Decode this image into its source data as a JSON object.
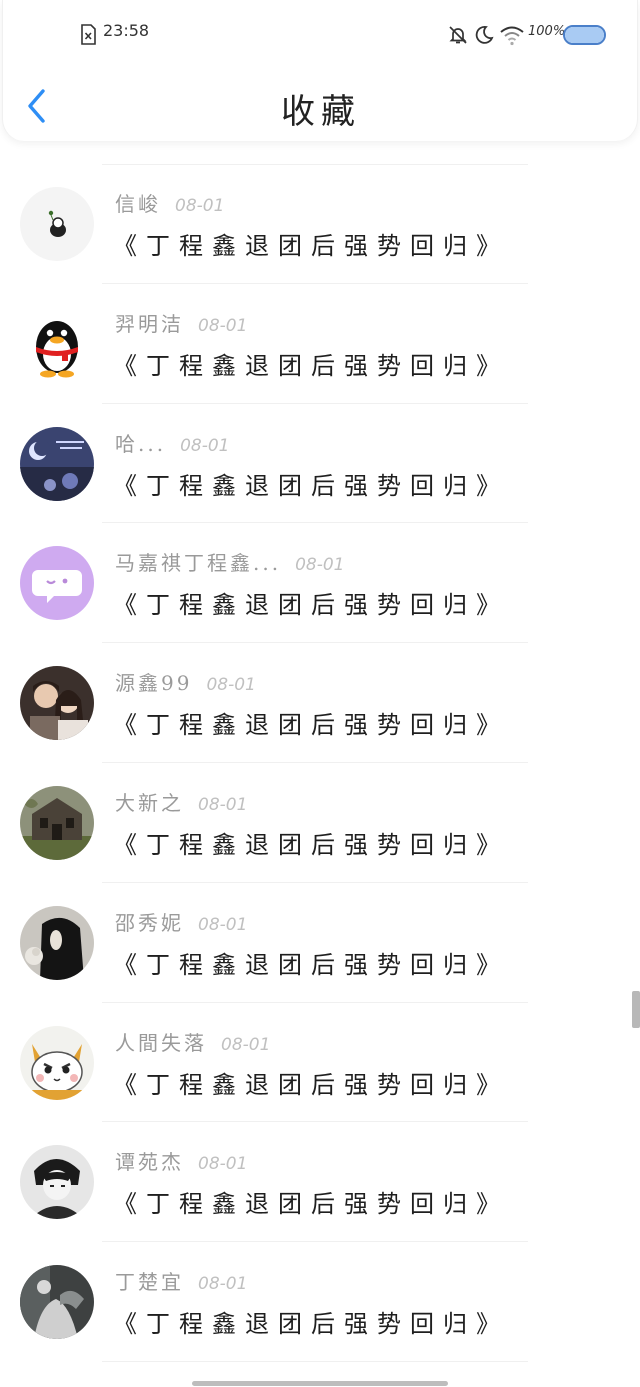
{
  "status_bar": {
    "time": "23:58",
    "battery_percent": "100%",
    "battery_level": 1.0
  },
  "header": {
    "title": "收藏",
    "back_icon": "chevron-left-icon",
    "accent_color": "#2e8ef5"
  },
  "items": [
    {
      "name": "信峻",
      "date": "08-01",
      "content": "《丁程鑫退团后强势回归》",
      "avatar": "white-ghost-avatar"
    },
    {
      "name": "羿明洁",
      "date": "08-01",
      "content": "《丁程鑫退团后强势回归》",
      "avatar": "penguin-avatar"
    },
    {
      "name": "哈...",
      "date": "08-01",
      "content": "《丁程鑫退团后强势回归》",
      "avatar": "night-sky-avatar"
    },
    {
      "name": "马嘉祺丁程鑫...",
      "date": "08-01",
      "content": "《丁程鑫退团后强势回归》",
      "avatar": "purple-chat-avatar"
    },
    {
      "name": "源鑫99",
      "date": "08-01",
      "content": "《丁程鑫退团后强势回归》",
      "avatar": "couple-photo-avatar"
    },
    {
      "name": "大新之",
      "date": "08-01",
      "content": "《丁程鑫退团后强势回归》",
      "avatar": "old-house-avatar"
    },
    {
      "name": "邵秀妮",
      "date": "08-01",
      "content": "《丁程鑫退团后强势回归》",
      "avatar": "dark-hair-avatar"
    },
    {
      "name": "人間失落",
      "date": "08-01",
      "content": "《丁程鑫退团后强势回归》",
      "avatar": "cartoon-cat-avatar"
    },
    {
      "name": "谭苑杰",
      "date": "08-01",
      "content": "《丁程鑫退团后强势回归》",
      "avatar": "anime-boy-avatar"
    },
    {
      "name": "丁楚宜",
      "date": "08-01",
      "content": "《丁程鑫退团后强势回归》",
      "avatar": "grey-portrait-avatar"
    }
  ]
}
